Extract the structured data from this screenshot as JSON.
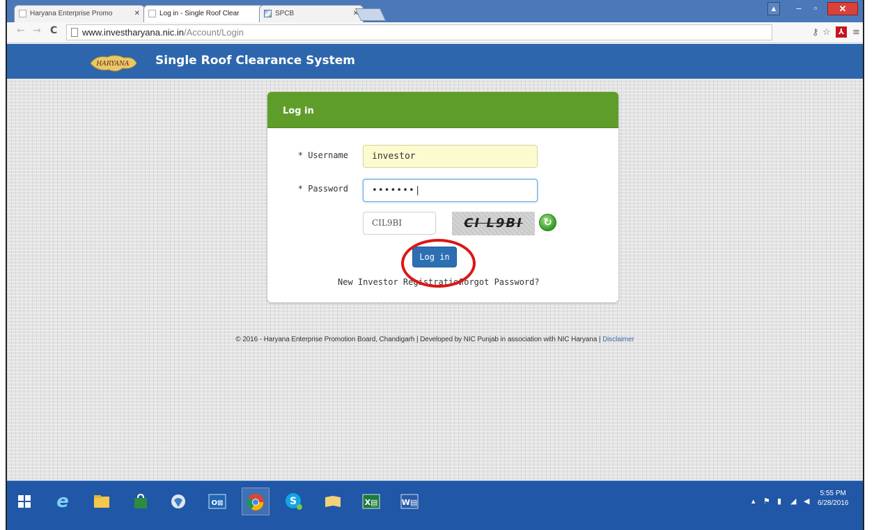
{
  "browser": {
    "tabs": [
      {
        "label": "Haryana Enterprise Promo",
        "active": false
      },
      {
        "label": "Log in - Single Roof Clear",
        "active": true
      },
      {
        "label": "SPCB",
        "active": false
      }
    ],
    "url_host": "www.investharyana.nic.in",
    "url_path": "/Account/Login"
  },
  "site": {
    "logo_text": "HARYANA",
    "title": "Single Roof Clearance System"
  },
  "login": {
    "heading": "Log in",
    "username_label": "* Username",
    "username_value": "investor",
    "password_label": "* Password",
    "password_value": "•••••••|",
    "captcha_input_value": "CIL9BI",
    "captcha_image_text": "CI L9BI",
    "submit_label": "Log in",
    "register_link": "New Investor Registration",
    "forgot_link": "Forgot Password?"
  },
  "footer": {
    "text": "© 2016 - Haryana Enterprise Promotion Board, Chandigarh | Developed by NIC Punjab in association with NIC Haryana |",
    "disclaimer": "Disclaimer"
  },
  "taskbar": {
    "apps": [
      "windows-start",
      "internet-explorer",
      "file-explorer",
      "store",
      "network",
      "outlook",
      "chrome",
      "skype",
      "folder",
      "excel",
      "word"
    ],
    "time": "5:55 PM",
    "date": "6/28/2016"
  },
  "colors": {
    "site_header": "#2d66ad",
    "panel_header": "#5f9d2b",
    "button": "#2d6fb3",
    "annotation_ring": "#dd1515"
  }
}
